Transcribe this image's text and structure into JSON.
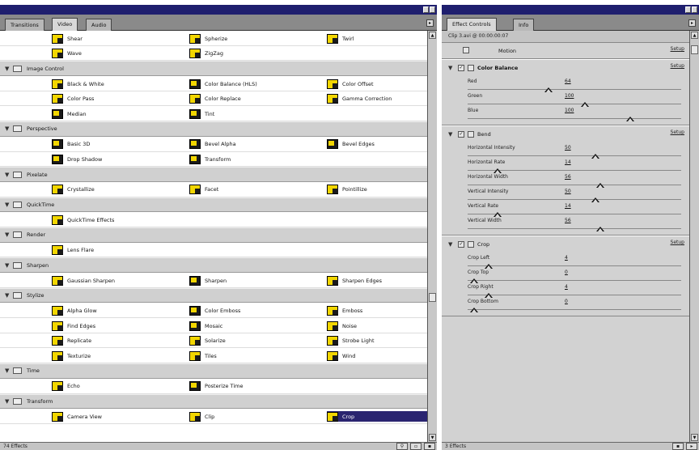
{
  "left_panel": {
    "tabs": [
      {
        "label": "Transitions"
      },
      {
        "label": "Video"
      },
      {
        "label": "Audio"
      }
    ],
    "status": "74 Effects",
    "categories": [
      {
        "name": "",
        "rows": [
          [
            "Shear",
            "Spherize",
            "Twirl"
          ],
          [
            "Wave",
            "ZigZag",
            ""
          ]
        ]
      },
      {
        "name": "Image Control",
        "rows": [
          [
            "Black & White",
            "Color Balance (HLS)",
            "Color Offset"
          ],
          [
            "Color Pass",
            "Color Replace",
            "Gamma Correction"
          ],
          [
            "Median",
            "Tint",
            ""
          ]
        ]
      },
      {
        "name": "Perspective",
        "rows": [
          [
            "Basic 3D",
            "Bevel Alpha",
            "Bevel Edges"
          ],
          [
            "Drop Shadow",
            "Transform",
            ""
          ]
        ]
      },
      {
        "name": "Pixelate",
        "rows": [
          [
            "Crystallize",
            "Facet",
            "Pointillize"
          ]
        ]
      },
      {
        "name": "QuickTime",
        "rows": [
          [
            "QuickTime Effects",
            "",
            ""
          ]
        ]
      },
      {
        "name": "Render",
        "rows": [
          [
            "Lens Flare",
            "",
            ""
          ]
        ]
      },
      {
        "name": "Sharpen",
        "rows": [
          [
            "Gaussian Sharpen",
            "Sharpen",
            "Sharpen Edges"
          ]
        ]
      },
      {
        "name": "Stylize",
        "rows": [
          [
            "Alpha Glow",
            "Color Emboss",
            "Emboss"
          ],
          [
            "Find Edges",
            "Mosaic",
            "Noise"
          ],
          [
            "Replicate",
            "Solarize",
            "Strobe Light"
          ],
          [
            "Texturize",
            "Tiles",
            "Wind"
          ]
        ]
      },
      {
        "name": "Time",
        "rows": [
          [
            "Echo",
            "Posterize Time",
            ""
          ]
        ]
      },
      {
        "name": "Transform",
        "rows": [
          [
            "Camera View",
            "Clip",
            "Crop"
          ]
        ]
      }
    ],
    "selected_effect": "Crop"
  },
  "right_panel": {
    "tabs": [
      {
        "label": "Effect Controls"
      },
      {
        "label": "Info"
      }
    ],
    "clip_info": "Clip 3.avi @ 00:00:00:07",
    "status": "3 Effects",
    "setup_label": "Setup",
    "motion_label": "Motion",
    "blocks": [
      {
        "name": "Color Balance",
        "params": [
          {
            "label": "Red",
            "value": "64",
            "slider": 0.38
          },
          {
            "label": "Green",
            "value": "100",
            "slider": 0.55
          },
          {
            "label": "Blue",
            "value": "100",
            "slider": 0.76
          }
        ]
      },
      {
        "name": "Bend",
        "params": [
          {
            "label": "Horizontal Intensity",
            "value": "50",
            "slider": 0.6
          },
          {
            "label": "Horizontal Rate",
            "value": "14",
            "slider": 0.14
          },
          {
            "label": "Horizontal Width",
            "value": "56",
            "slider": 0.62
          },
          {
            "label": "Vertical Intensity",
            "value": "50",
            "slider": 0.6
          },
          {
            "label": "Vertical Rate",
            "value": "14",
            "slider": 0.14
          },
          {
            "label": "Vertical Width",
            "value": "56",
            "slider": 0.62
          }
        ]
      },
      {
        "name": "Crop",
        "params": [
          {
            "label": "Crop Left",
            "value": "4",
            "slider": 0.1
          },
          {
            "label": "Crop Top",
            "value": "0",
            "slider": 0.03
          },
          {
            "label": "Crop Right",
            "value": "4",
            "slider": 0.1
          },
          {
            "label": "Crop Bottom",
            "value": "0",
            "slider": 0.03
          }
        ]
      }
    ]
  }
}
